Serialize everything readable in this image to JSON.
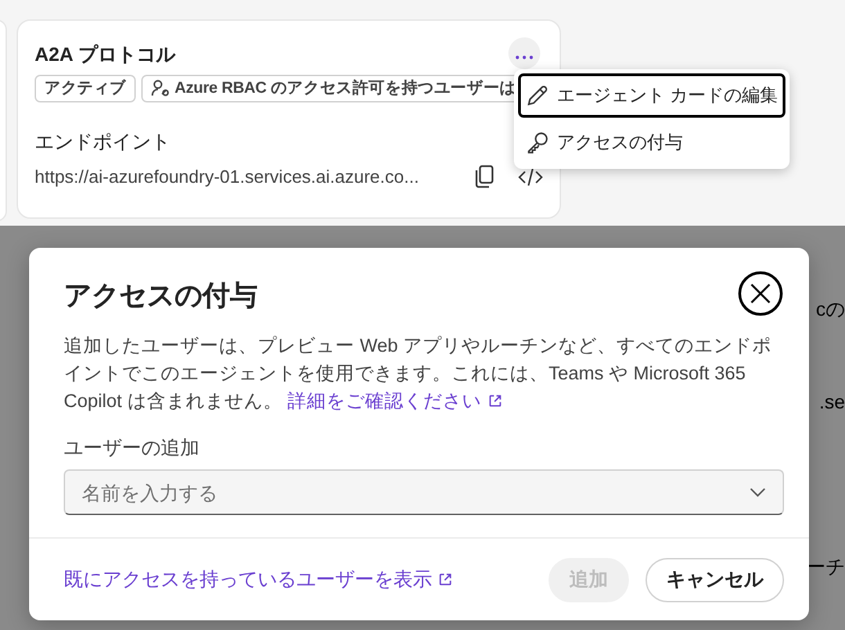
{
  "card": {
    "title": "A2A プロトコル",
    "badges": [
      {
        "kind": "plain",
        "label": "アクティブ"
      },
      {
        "kind": "access",
        "label": "Azure RBAC のアクセス許可を持つユーザーは"
      }
    ],
    "endpoint_label": "エンドポイント",
    "endpoint_url": "https://ai-azurefoundry-01.services.ai.azure.co..."
  },
  "menu": {
    "items": [
      {
        "kind": "edit",
        "label": "エージェント カードの編集",
        "focused": true
      },
      {
        "kind": "key",
        "label": "アクセスの付与",
        "focused": false
      }
    ]
  },
  "background_fragments": [
    "cの",
    ".se",
    "ーチ"
  ],
  "dialog": {
    "title": "アクセスの付与",
    "description": "追加したユーザーは、プレビュー Web アプリやルーチンなど、すべてのエンドポイントでこのエージェントを使用できます。これには、Teams や Microsoft 365 Copilot は含まれません。",
    "learn_more": "詳細をご確認ください",
    "field_label": "ユーザーの追加",
    "field": {
      "placeholder": "名前を入力する"
    },
    "footer_link": "既にアクセスを持っているユーザーを表示",
    "buttons": [
      {
        "kind": "primary",
        "label": "追加",
        "disabled": true
      },
      {
        "kind": "secondary",
        "label": "キャンセル",
        "disabled": false
      }
    ]
  }
}
